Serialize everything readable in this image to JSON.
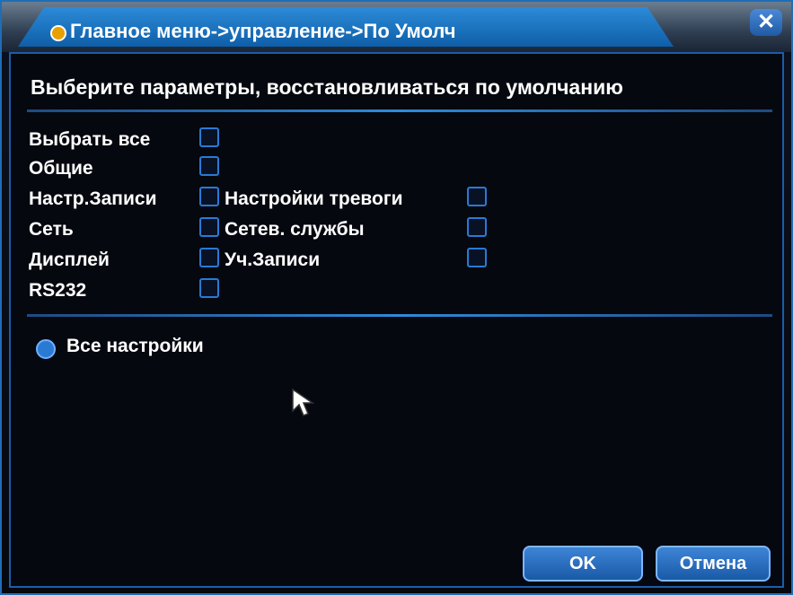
{
  "title": "Главное меню->управление->По Умолч",
  "header": "Выберите параметры, восстановливаться по умолчанию",
  "options_left": [
    {
      "label": "Выбрать все",
      "checked": false
    },
    {
      "label": "Общие",
      "checked": false
    },
    {
      "label": "Настр.Записи",
      "checked": false
    },
    {
      "label": "Сеть",
      "checked": false
    },
    {
      "label": "Дисплей",
      "checked": false
    },
    {
      "label": "RS232",
      "checked": false
    }
  ],
  "options_right": [
    {
      "label": "Настройки тревоги",
      "checked": false
    },
    {
      "label": "Сетев. службы",
      "checked": false
    },
    {
      "label": "Уч.Записи",
      "checked": false
    }
  ],
  "all_settings_label": "Все настройки",
  "buttons": {
    "ok": "OK",
    "cancel": "Отмена"
  },
  "icons": {
    "close": "close-icon",
    "cursor": "mouse-pointer-icon"
  },
  "colors": {
    "accent": "#1f6db8",
    "checkbox": "#2a7ad4",
    "text": "#ffffff"
  }
}
